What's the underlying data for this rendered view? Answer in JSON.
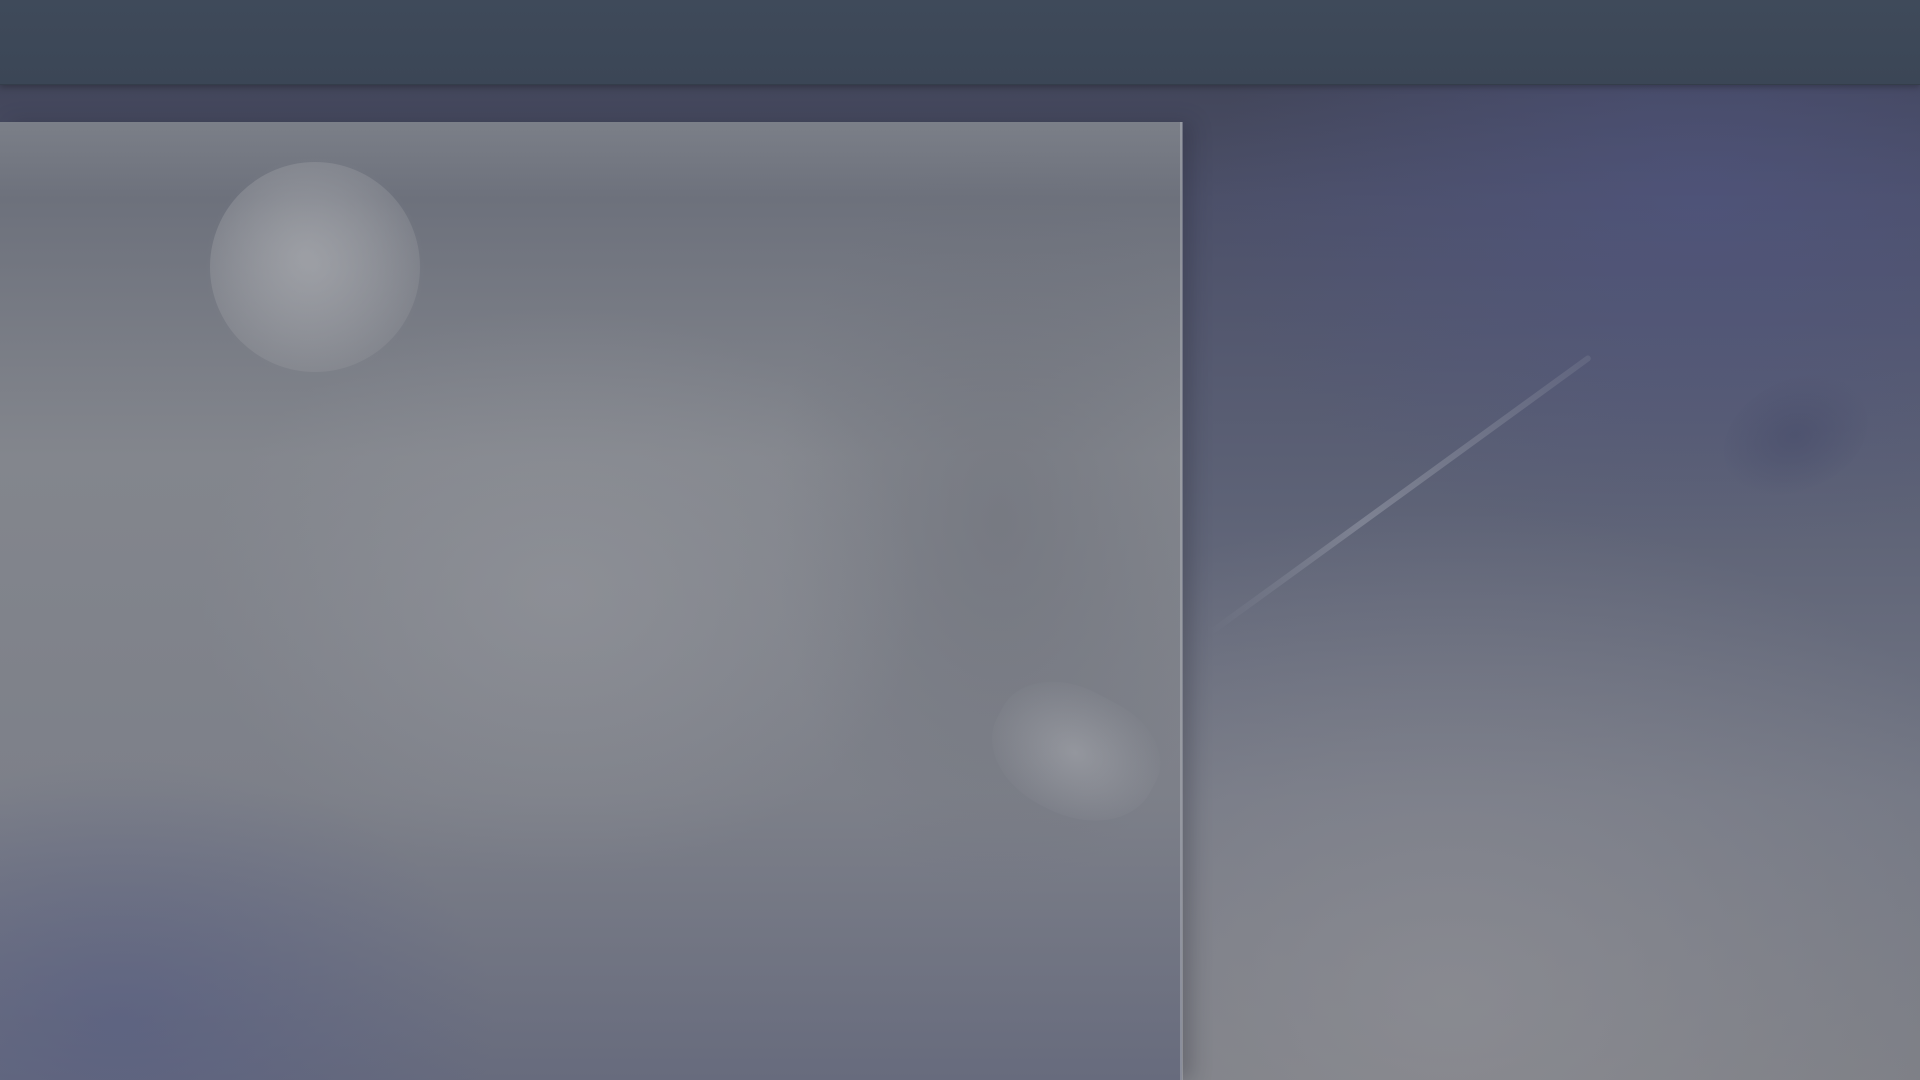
{
  "window": {
    "top_bar_color": "#3e4959",
    "background_tone": "#5d6276"
  },
  "scene": {
    "foreground_panel_color": "#7e8189",
    "accent_color": "#4c5069"
  }
}
